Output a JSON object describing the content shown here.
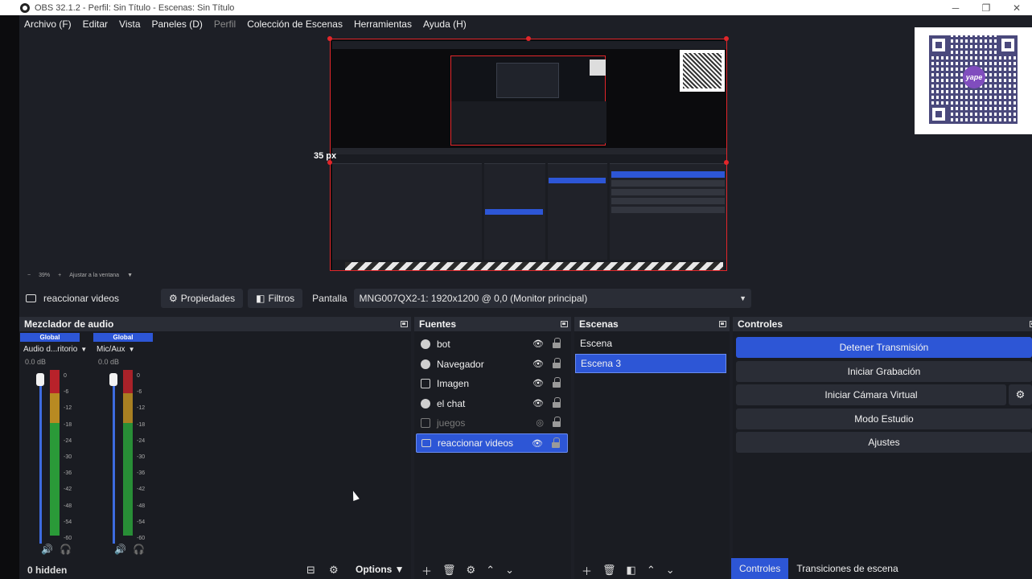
{
  "window": {
    "title": "OBS 32.1.2 - Perfil: Sin Título - Escenas: Sin Título",
    "minimize": "─",
    "maximize": "❐",
    "close": "✕"
  },
  "menu": [
    {
      "label": "Archivo (F)",
      "enabled": true
    },
    {
      "label": "Editar",
      "enabled": true
    },
    {
      "label": "Vista",
      "enabled": true
    },
    {
      "label": "Paneles (D)",
      "enabled": true
    },
    {
      "label": "Perfil",
      "enabled": false
    },
    {
      "label": "Colección de Escenas",
      "enabled": true
    },
    {
      "label": "Herramientas",
      "enabled": true
    },
    {
      "label": "Ayuda (H)",
      "enabled": true
    }
  ],
  "preview": {
    "size_label": "35 px",
    "qr_logo": "yape",
    "zoom_minus": "−",
    "zoom_value": "39%",
    "zoom_plus": "+",
    "fit_label": "Ajustar a la ventana"
  },
  "source_toolbar": {
    "current_source": "reaccionar videos",
    "properties_label": "Propiedades",
    "filters_label": "Filtros",
    "screen_label": "Pantalla",
    "screen_value": "MNG007QX2-1: 1920x1200 @ 0,0 (Monitor principal)"
  },
  "mixer": {
    "title": "Mezclador de audio",
    "channels": [
      {
        "group": "Global",
        "name": "Audio d...ritorio",
        "db": "0.0 dB",
        "level": 0.72
      },
      {
        "group": "Global",
        "name": "Mic/Aux",
        "db": "0.0 dB",
        "level": 0.62
      }
    ],
    "scale": [
      "0",
      "-6",
      "-12",
      "-18",
      "-24",
      "-30",
      "-36",
      "-42",
      "-48",
      "-54",
      "-60"
    ],
    "hidden_count": "0 hidden",
    "options_label": "Options"
  },
  "sources": {
    "title": "Fuentes",
    "items": [
      {
        "name": "bot",
        "icon": "globe-icon",
        "visible": true,
        "selected": false
      },
      {
        "name": "Navegador",
        "icon": "globe-icon",
        "visible": true,
        "selected": false
      },
      {
        "name": "Imagen",
        "icon": "image-icon",
        "visible": true,
        "selected": false
      },
      {
        "name": "el chat",
        "icon": "globe-icon",
        "visible": true,
        "selected": false
      },
      {
        "name": "juegos",
        "icon": "window-icon",
        "visible": false,
        "selected": false
      },
      {
        "name": "reaccionar videos",
        "icon": "monitor-icon",
        "visible": true,
        "selected": true
      }
    ]
  },
  "scenes": {
    "title": "Escenas",
    "items": [
      {
        "name": "Escena",
        "selected": false
      },
      {
        "name": "Escena 3",
        "selected": true
      }
    ]
  },
  "controls": {
    "title": "Controles",
    "stop_stream": "Detener Transmisión",
    "start_recording": "Iniciar Grabación",
    "start_virtual_cam": "Iniciar Cámara Virtual",
    "studio_mode": "Modo Estudio",
    "settings": "Ajustes",
    "tab_controls": "Controles",
    "tab_transitions": "Transiciones de escena"
  },
  "colors": {
    "accent": "#2d56d6",
    "background": "#1d1f26",
    "panel": "#1a1c22",
    "selection_border": "#e2262a"
  }
}
